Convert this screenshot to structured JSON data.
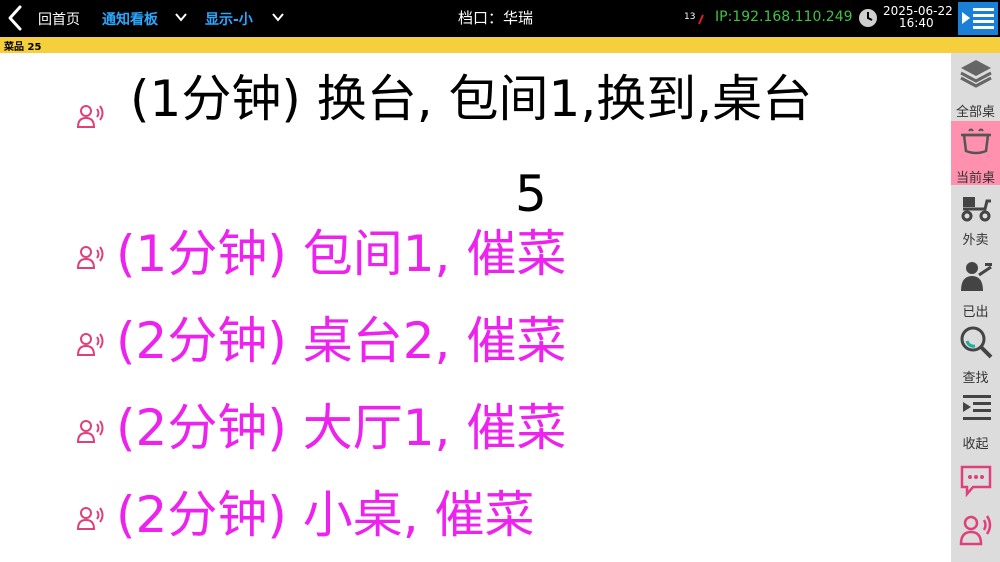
{
  "topbar": {
    "home_label": "回首页",
    "notice_board_label": "通知看板",
    "display_label": "显示-小",
    "stall_label": "档口：华瑞",
    "count": "13",
    "ip": "IP:192.168.110.249",
    "date": "2025-06-22",
    "time": "16:40"
  },
  "strip": {
    "dish_count": "菜品 25"
  },
  "notifications": [
    {
      "text_line1": "(1分钟) 换台, 包间1,换到,桌台",
      "text_line2": "5",
      "color": "#000000"
    },
    {
      "text": "(1分钟) 包间1, 催菜",
      "color": "#ee22ee"
    },
    {
      "text": "(2分钟) 桌台2, 催菜",
      "color": "#ee22ee"
    },
    {
      "text": "(2分钟) 大厅1, 催菜",
      "color": "#ee22ee"
    },
    {
      "text": "(2分钟) 小桌, 催菜",
      "color": "#ee22ee"
    }
  ],
  "sidebar": {
    "items": [
      {
        "label": "全部桌",
        "icon": "layers-icon"
      },
      {
        "label": "当前桌",
        "icon": "pot-icon"
      },
      {
        "label": "外卖",
        "icon": "scooter-icon"
      },
      {
        "label": "已出",
        "icon": "waiter-icon"
      },
      {
        "label": "查找",
        "icon": "search-icon"
      },
      {
        "label": "收起",
        "icon": "collapse-icon"
      },
      {
        "label": "",
        "icon": "message-icon"
      },
      {
        "label": "",
        "icon": "speaker-person-icon"
      }
    ]
  },
  "colors": {
    "accent_blue": "#29a8ff",
    "ip_green": "#3fc43f",
    "strip_yellow": "#f5cf3c",
    "urge_magenta": "#ee22ee",
    "active_pink": "#ff90ae",
    "icon_pink": "#e0407a"
  }
}
